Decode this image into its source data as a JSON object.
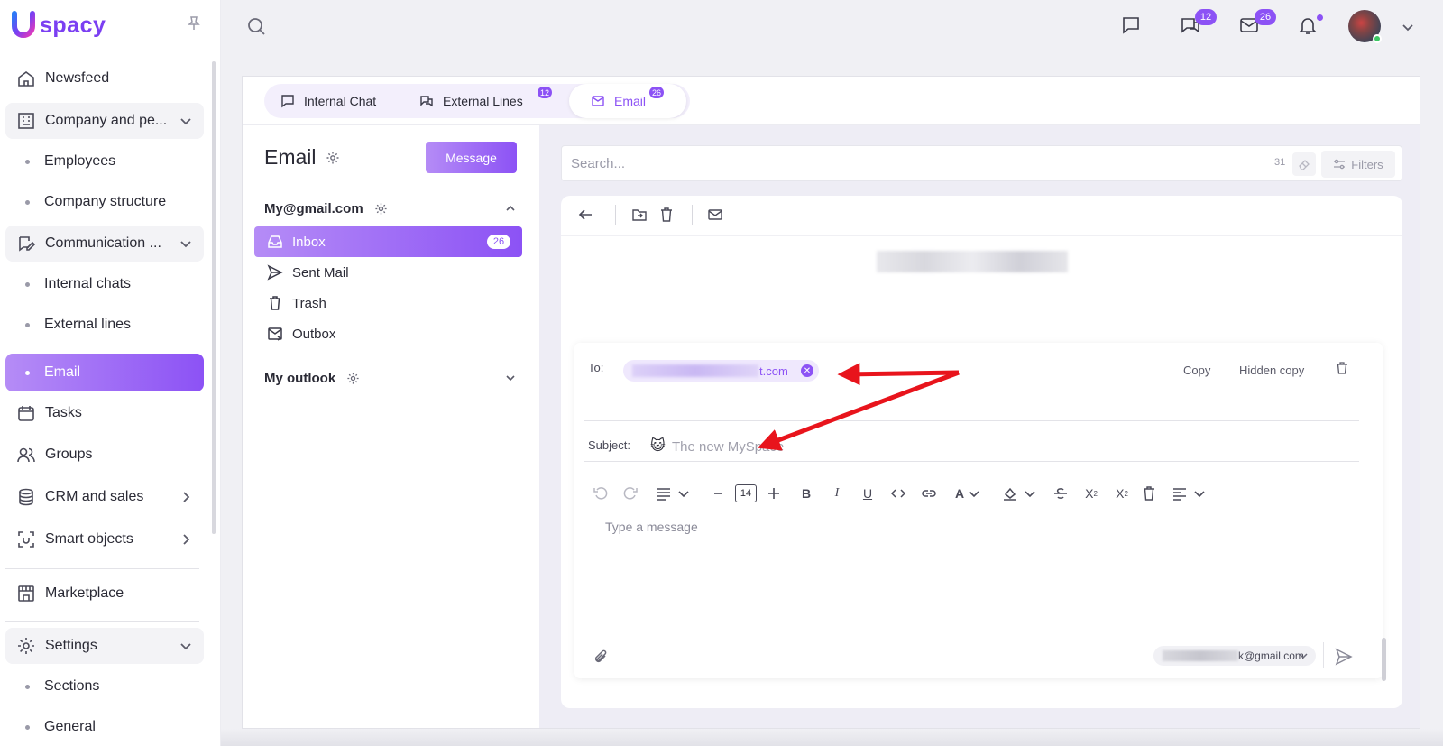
{
  "app": {
    "logo_text": "spacy",
    "logo_letter": "U"
  },
  "sidebar": {
    "items": [
      {
        "label": "Newsfeed",
        "icon": "home-icon"
      },
      {
        "label": "Company and pe...",
        "icon": "building-icon"
      },
      {
        "label": "Employees"
      },
      {
        "label": "Company structure"
      },
      {
        "label": "Communication ...",
        "icon": "chat-edit-icon"
      },
      {
        "label": "Internal chats"
      },
      {
        "label": "External lines"
      },
      {
        "label": "Email"
      },
      {
        "label": "Tasks",
        "icon": "calendar-icon"
      },
      {
        "label": "Groups",
        "icon": "users-icon"
      },
      {
        "label": "CRM and sales",
        "icon": "database-icon"
      },
      {
        "label": "Smart objects",
        "icon": "scan-icon"
      },
      {
        "label": "Marketplace",
        "icon": "store-icon"
      },
      {
        "label": "Settings",
        "icon": "gear-icon"
      },
      {
        "label": "Sections"
      },
      {
        "label": "General"
      }
    ]
  },
  "topbar": {
    "chats_badge": "12",
    "mail_badge": "26"
  },
  "tabs": [
    {
      "label": "Internal Chat"
    },
    {
      "label": "External Lines",
      "badge": "12"
    },
    {
      "label": "Email",
      "badge": "26"
    }
  ],
  "mail": {
    "title": "Email",
    "message_button": "Message",
    "accounts": [
      {
        "name": "My@gmail.com"
      },
      {
        "name": "My outlook"
      }
    ],
    "folders": [
      {
        "label": "Inbox",
        "count": "26"
      },
      {
        "label": "Sent Mail"
      },
      {
        "label": "Trash"
      },
      {
        "label": "Outbox"
      }
    ]
  },
  "search": {
    "placeholder": "Search...",
    "count": "31",
    "filters_label": "Filters"
  },
  "compose": {
    "to_label": "To:",
    "to_chip_visible": "t.com",
    "copy_label": "Copy",
    "hidden_copy_label": "Hidden copy",
    "subject_label": "Subject:",
    "subject_emoji": "😺",
    "subject_placeholder": "The new MySpace",
    "font_size": "14",
    "message_placeholder": "Type a message",
    "from_visible": "k@gmail.com"
  },
  "colors": {
    "accent": "#8c52f5",
    "accent_light": "#b58cf6",
    "arrow": "#e8141c"
  }
}
